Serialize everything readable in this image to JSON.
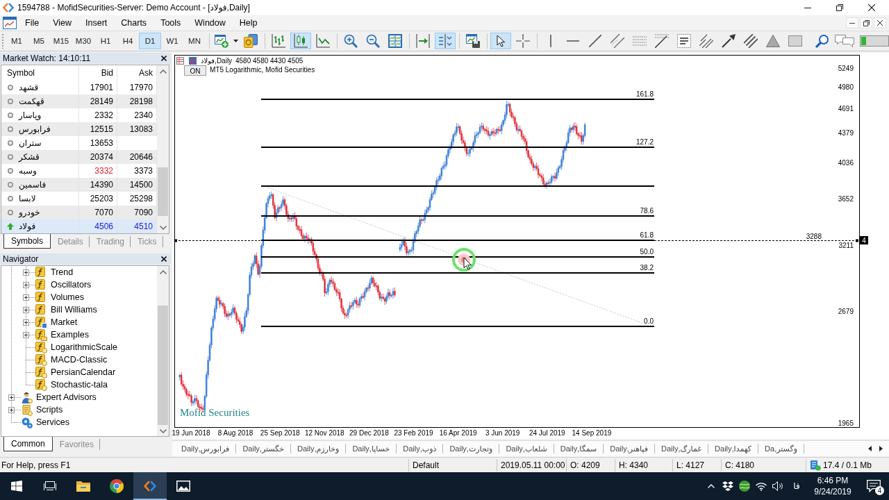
{
  "window": {
    "title": "1594788 - MofidSecurities-Server: Demo Account - [فولاد,Daily]"
  },
  "menu": [
    "File",
    "View",
    "Insert",
    "Charts",
    "Tools",
    "Window",
    "Help"
  ],
  "toolbar": {
    "timeframes": [
      {
        "label": "M1",
        "selected": false
      },
      {
        "label": "M5",
        "selected": false
      },
      {
        "label": "M15",
        "selected": false
      },
      {
        "label": "M30",
        "selected": false
      },
      {
        "label": "H1",
        "selected": false
      },
      {
        "label": "H4",
        "selected": false
      },
      {
        "label": "D1",
        "selected": true
      },
      {
        "label": "W1",
        "selected": false
      },
      {
        "label": "MN",
        "selected": false
      }
    ],
    "chart_types": [
      {
        "kind": "bars",
        "selected": false
      },
      {
        "kind": "candles",
        "selected": true
      },
      {
        "kind": "line",
        "selected": false
      }
    ],
    "chart_shift": false,
    "auto_scroll": true,
    "pointers": [
      {
        "kind": "cursor",
        "selected": true
      },
      {
        "kind": "crosshair",
        "selected": false
      }
    ]
  },
  "market_watch": {
    "title": "Market Watch: 14:10:11",
    "columns": [
      "Symbol",
      "Bid",
      "Ask"
    ],
    "rows": [
      {
        "symbol": "قشهد",
        "bid": "17901",
        "ask": "17970",
        "rising": false,
        "bid_up": false,
        "bid_down": false,
        "ask_up": false,
        "selected": false
      },
      {
        "symbol": "قهکمت",
        "bid": "28149",
        "ask": "28198",
        "rising": false,
        "bid_up": false,
        "bid_down": false,
        "ask_up": false,
        "selected": false
      },
      {
        "symbol": "وپاسار",
        "bid": "2332",
        "ask": "2340",
        "rising": false,
        "bid_up": false,
        "bid_down": false,
        "ask_up": false,
        "selected": false
      },
      {
        "symbol": "فرابورس",
        "bid": "12515",
        "ask": "13083",
        "rising": false,
        "bid_up": false,
        "bid_down": false,
        "ask_up": false,
        "selected": false
      },
      {
        "symbol": "ستران",
        "bid": "13653",
        "rising": false,
        "bid_up": false,
        "bid_down": false,
        "selected": false
      },
      {
        "symbol": "قشکر",
        "bid": "20374",
        "ask": "20646",
        "rising": false,
        "bid_up": false,
        "bid_down": false,
        "ask_up": false,
        "selected": false
      },
      {
        "symbol": "وسبه",
        "bid": "3332",
        "ask": "3373",
        "rising": false,
        "bid_up": false,
        "bid_down": true,
        "ask_up": false,
        "selected": false
      },
      {
        "symbol": "فاسمین",
        "bid": "14390",
        "ask": "14500",
        "rising": false,
        "bid_up": false,
        "bid_down": false,
        "ask_up": false,
        "selected": false
      },
      {
        "symbol": "لابسا",
        "bid": "25203",
        "ask": "25298",
        "rising": false,
        "bid_up": false,
        "bid_down": false,
        "ask_up": false,
        "selected": false
      },
      {
        "symbol": "خودرو",
        "bid": "7070",
        "ask": "7090",
        "rising": false,
        "bid_up": false,
        "bid_down": false,
        "ask_up": false,
        "selected": false
      },
      {
        "symbol": "فولاد",
        "bid": "4506",
        "ask": "4510",
        "rising": true,
        "bid_up": true,
        "bid_down": false,
        "ask_up": true,
        "selected": true
      }
    ],
    "tabs": [
      {
        "label": "Symbols",
        "selected": true
      },
      {
        "label": "Details",
        "selected": false
      },
      {
        "label": "Trading",
        "selected": false
      },
      {
        "label": "Ticks",
        "selected": false
      }
    ]
  },
  "navigator": {
    "title": "Navigator",
    "items": [
      {
        "children": [
          {
            "label": "Trend",
            "kind": "group",
            "expanded": false
          },
          {
            "label": "Oscillators",
            "kind": "group",
            "expanded": false
          },
          {
            "label": "Volumes",
            "kind": "group",
            "expanded": false
          },
          {
            "label": "Bill Williams",
            "kind": "group",
            "expanded": false
          },
          {
            "label": "Market",
            "kind": "market",
            "expanded": false
          },
          {
            "label": "Examples",
            "kind": "folder",
            "expanded": false
          },
          {
            "label": "LogarithmicScale",
            "kind": "indicator"
          },
          {
            "label": "MACD-Classic",
            "kind": "indicator"
          },
          {
            "label": "PersianCalendar",
            "kind": "indicator"
          },
          {
            "label": "Stochastic-tala",
            "kind": "indicator"
          }
        ]
      },
      {
        "label": "Expert Advisors",
        "kind": "experts",
        "expanded": false
      },
      {
        "label": "Scripts",
        "kind": "scripts",
        "expanded": false
      },
      {
        "label": "Services",
        "kind": "services"
      }
    ],
    "tabs": [
      {
        "label": "Common",
        "selected": true
      },
      {
        "label": "Favorites",
        "selected": false
      }
    ]
  },
  "chart": {
    "symbol": "فولاد,Daily",
    "prices": "4580 4580 4430 4505",
    "indicator_toggle": "ON",
    "indicator": "MT5 Logarithmic, Mofid Securities",
    "price_labels": [
      "5249",
      "4980",
      "4691",
      "4379",
      "4036",
      "3652",
      "3211",
      "2679",
      "1965"
    ],
    "line_label": "3288",
    "axis_marker": "4",
    "fib_levels": [
      "161.8",
      "127.2",
      "78.6",
      "61.8",
      "50.0",
      "38.2",
      "0.0"
    ],
    "date_labels": [
      "19 Jun 2018",
      "8 Aug 2018",
      "25 Sep 2018",
      "12 Nov 2018",
      "29 Dec 2018",
      "23 Feb 2019",
      "16 Apr 2019",
      "3 Jun 2019",
      "24 Jul 2019",
      "14 Sep 2019"
    ],
    "brand_label": "Mofid Securities"
  },
  "chart_tabs": [
    "فرابورس,Daily",
    "خگستر,Daily",
    "وخارزم,Daily",
    "خساپا,Daily",
    "ذوب,Daily",
    "وتجارت,Daily",
    "شلعاب,Daily",
    "سمگا,Daily",
    "فپاهنر,Daily",
    "غمارگ,Daily",
    "کهمدا,Daily",
    "وگستر,Da"
  ],
  "status_bar": {
    "help": "For Help, press F1",
    "profile": "Default",
    "time": "2019.05.11 00:00",
    "open": "O: 4209",
    "high": "H: 4340",
    "low": "L: 4127",
    "close": "C: 4180",
    "traffic": "17.4 / 0.1 Mb"
  },
  "taskbar": {
    "language": "فا",
    "time": "6:46 PM",
    "date": "9/24/2019",
    "notifications": "4"
  }
}
